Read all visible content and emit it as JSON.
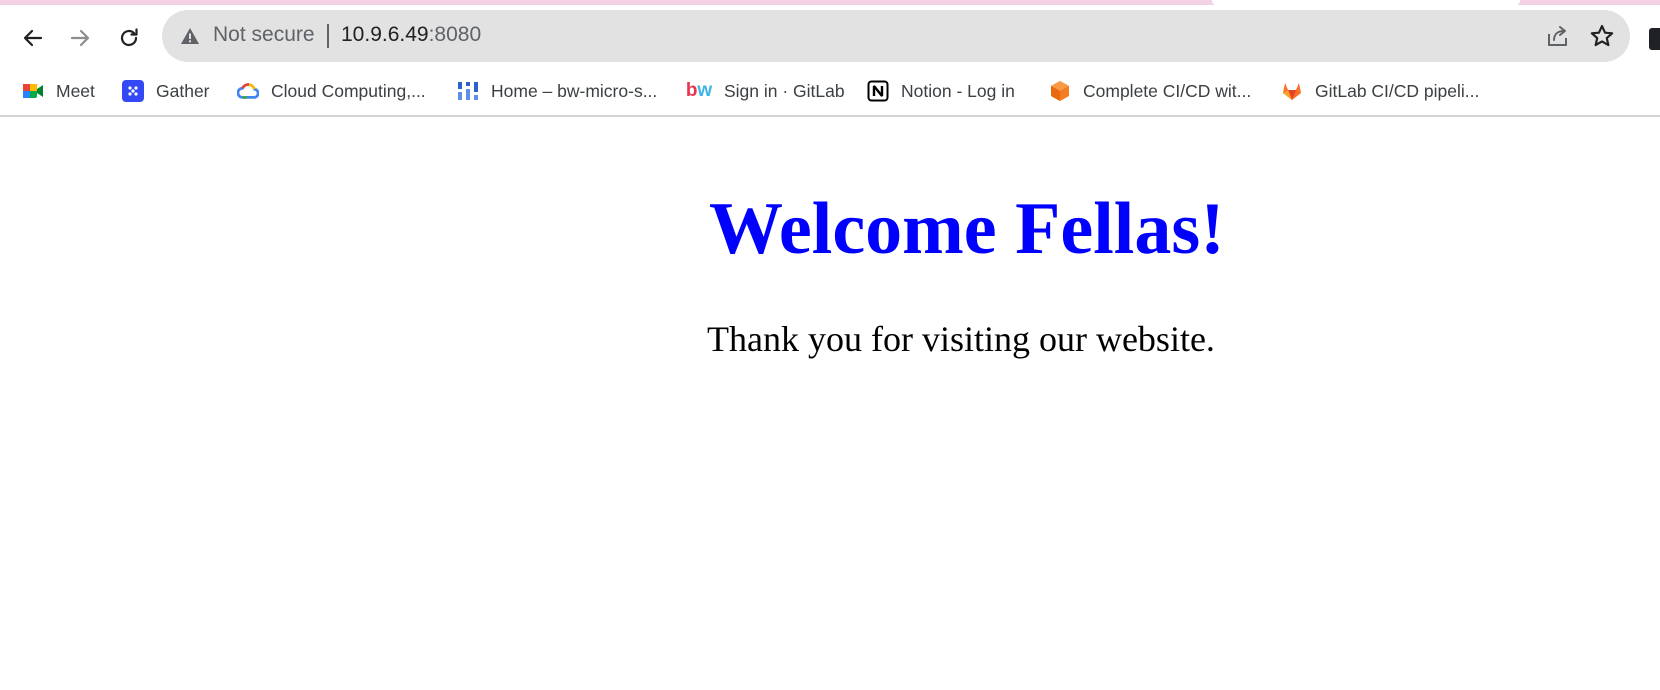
{
  "browser": {
    "nav": {
      "back_icon": "arrow-left-icon",
      "forward_icon": "arrow-right-icon",
      "reload_icon": "reload-icon"
    },
    "omnibox": {
      "security_icon": "warning-triangle-icon",
      "security_status": "Not secure",
      "url_host": "10.9.6.49",
      "url_port": ":8080",
      "share_icon": "share-icon",
      "bookmark_icon": "star-icon"
    },
    "bookmarks": [
      {
        "label": "Meet",
        "icon": "google-meet-icon"
      },
      {
        "label": "Gather",
        "icon": "gather-icon"
      },
      {
        "label": "Cloud Computing,...",
        "icon": "google-cloud-icon"
      },
      {
        "label": "Home – bw-micro-s...",
        "icon": "dashboard-grid-icon"
      },
      {
        "label": "Sign in · GitLab",
        "icon": "bw-logo-icon"
      },
      {
        "label": "Notion - Log in",
        "icon": "notion-icon"
      },
      {
        "label": "Complete CI/CD wit...",
        "icon": "orange-cube-icon"
      },
      {
        "label": "GitLab CI/CD pipeli...",
        "icon": "gitlab-tanuki-icon"
      }
    ]
  },
  "page": {
    "heading": "Welcome Fellas!",
    "message": "Thank you for visiting our website."
  },
  "colors": {
    "heading": "#0000ff",
    "text": "#000000",
    "omnibox_bg": "#e2e2e2",
    "tabstrip_accent": "#f3d1e4"
  }
}
